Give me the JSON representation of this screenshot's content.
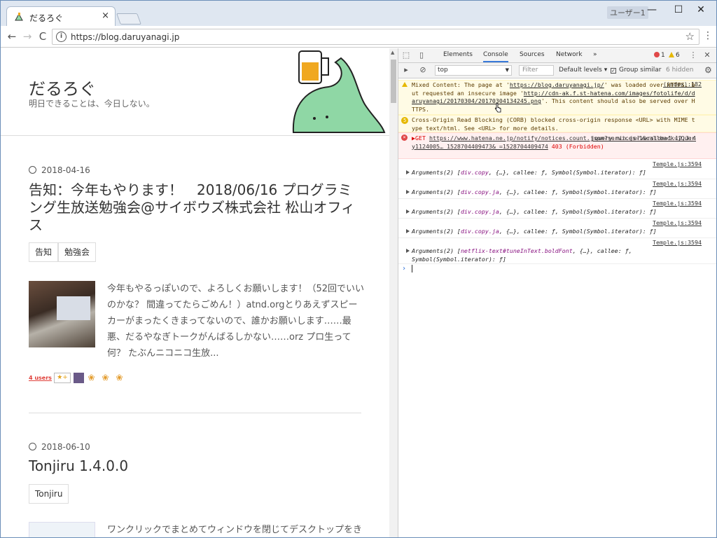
{
  "browser": {
    "tab_title": "だるろぐ",
    "tab_close": "×",
    "user_label": "ユーザー1",
    "minimize": "—",
    "maximize": "☐",
    "close": "✕",
    "back": "←",
    "forward": "→",
    "reload": "C",
    "url": "https://blog.daruyanagi.jp",
    "bookmark": "☆",
    "menu": "⋮"
  },
  "blog": {
    "title": "だるろぐ",
    "subtitle": "明日できることは、今日しない。",
    "posts": [
      {
        "date": "2018-04-16",
        "title": "告知：今年もやります！　2018/06/16 プログラミング生放送勉強会@サイボウズ株式会社 松山オフィス",
        "tags": [
          "告知",
          "勉強会"
        ],
        "excerpt": "今年もやるっぽいので、よろしくお願いします！（52回でいいのかな？ 間違ってたらごめん！）atnd.orgとりあえずスピーカーがまったくきまってないので、誰かお願いします……最悪、だるやなぎトークがんばるしかない……orz プロ生って何？ たぶんニコニコ生放...",
        "users": "4 users",
        "star": "★+"
      },
      {
        "date": "2018-06-10",
        "title": "Tonjiru 1.4.0.0",
        "tags": [
          "Tonjiru"
        ],
        "excerpt": "ワンクリックでまとめてウィンドウを閉じてデスクトップをき"
      }
    ]
  },
  "devtools": {
    "tabs": [
      "Elements",
      "Console",
      "Sources",
      "Network",
      "»"
    ],
    "active_tab": "Console",
    "error_count": "1",
    "warning_count": "6",
    "context": "top",
    "filter_placeholder": "Filter",
    "levels": "Default levels ▾",
    "group_similar": "Group similar",
    "hidden": "6 hidden",
    "messages": [
      {
        "type": "warning",
        "source": "(index):182",
        "text_a": "Mixed Content: The page at '",
        "link_a": "https://blog.daruyanagi.jp/",
        "text_b": "' was loaded over HTTPS, but requested an insecure image '",
        "link_b": "http://cdn-ak.f.st-hatena.com/images/fotolife/d/daruyanagi/20170304/20170304134245.png",
        "text_c": "'. This content should also be served over HTTPS."
      },
      {
        "type": "warning",
        "badge": "5",
        "text": "Cross-Origin Read Blocking (CORB) blocked cross-origin response <URL> with MIME type text/html. See <URL> for more details."
      },
      {
        "type": "error",
        "source": "jquery.min.js?version=1.12.3:4",
        "text_a": "▶GET ",
        "link": "https://www.hatena.ne.jp/notify/notices.count.json?services=1&callback=jQuery1124005… 1528704409473&_=1528704409474",
        "text_b": " 403 (Forbidden)"
      }
    ],
    "logs": [
      {
        "source": "Temple.js:3594",
        "prefix": "Arguments(2) [",
        "cls": "div.copy",
        "rest": ", {…}, callee: ƒ, Symbol(Symbol.iterator): ƒ]"
      },
      {
        "source": "Temple.js:3594",
        "prefix": "Arguments(2) [",
        "cls": "div.copy.ja",
        "rest": ", {…}, callee: ƒ, Symbol(Symbol.iterator): ƒ]"
      },
      {
        "source": "Temple.js:3594",
        "prefix": "Arguments(2) [",
        "cls": "div.copy.ja",
        "rest": ", {…}, callee: ƒ, Symbol(Symbol.iterator): ƒ]"
      },
      {
        "source": "Temple.js:3594",
        "prefix": "Arguments(2) [",
        "cls": "div.copy.ja",
        "rest": ", {…}, callee: ƒ, Symbol(Symbol.iterator): ƒ]"
      },
      {
        "source": "Temple.js:3594",
        "prefix": "Arguments(2) [",
        "cls": "netflix-text#tuneInText.boldFont",
        "rest": ", {…}, callee: ƒ, Symbol(Symbol.iterator): ƒ]"
      }
    ],
    "prompt": "›"
  },
  "colors": {
    "accent": "#3879d9",
    "mascot": "#8fd7a5",
    "beer": "#f0a820",
    "error": "#e04848",
    "warning": "#e6b800"
  }
}
